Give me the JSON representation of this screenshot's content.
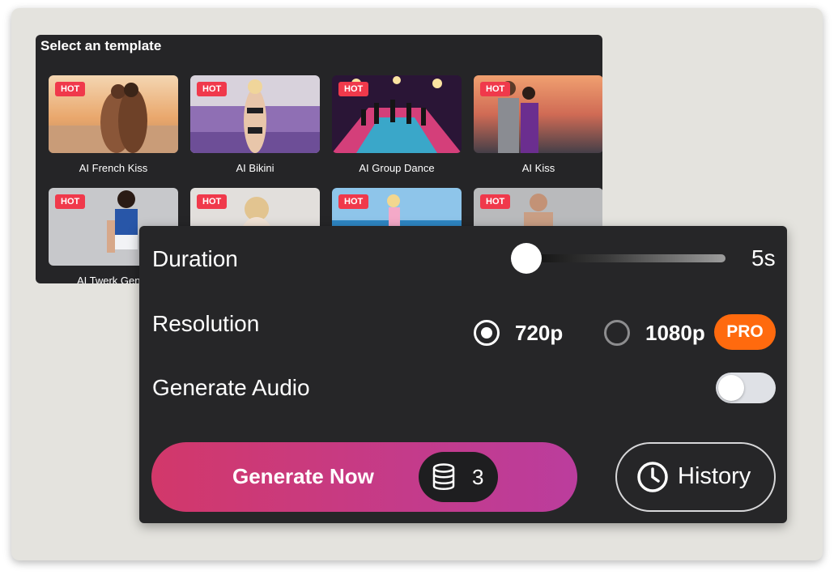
{
  "templates": {
    "title": "Select an template",
    "badge": "HOT",
    "items": [
      {
        "label": "AI French Kiss"
      },
      {
        "label": "AI Bikini"
      },
      {
        "label": "AI Group Dance"
      },
      {
        "label": "AI Kiss"
      },
      {
        "label": "AI Twerk Gener"
      },
      {
        "label": ""
      },
      {
        "label": ""
      },
      {
        "label": ""
      }
    ]
  },
  "settings": {
    "duration": {
      "label": "Duration",
      "value": "5s",
      "slider_fraction": 0
    },
    "resolution": {
      "label": "Resolution",
      "options": [
        {
          "label": "720p",
          "selected": true
        },
        {
          "label": "1080p",
          "selected": false
        }
      ],
      "pro_badge": "PRO"
    },
    "audio": {
      "label": "Generate Audio",
      "enabled": false
    }
  },
  "actions": {
    "generate_label": "Generate Now",
    "credit_icon": "coins-stack-icon",
    "credit_cost": "3",
    "history_label": "History",
    "history_icon": "clock-icon"
  },
  "colors": {
    "hot_badge": "#f0394b",
    "pro_badge": "#ff6a0e",
    "generate_gradient_start": "#d2386a",
    "generate_gradient_end": "#bb3d9d",
    "panel_bg": "#262628"
  }
}
